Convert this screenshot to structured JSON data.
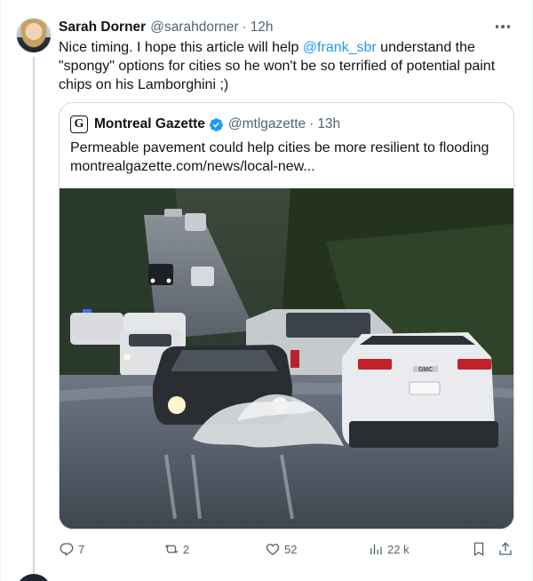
{
  "tweet": {
    "author_name": "Sarah Dorner",
    "author_handle": "@sarahdorner",
    "separator": "·",
    "time": "12h",
    "text_before": "Nice timing. I hope this article will help ",
    "mention": "@frank_sbr",
    "text_after": " understand the \"spongy\" options for cities so he won't be so terrified of potential paint chips on his Lamborghini ;)"
  },
  "quote": {
    "logo_letter": "G",
    "author_name": "Montreal Gazette",
    "author_handle": "@mtlgazette",
    "separator": "·",
    "time": "13h",
    "headline": "Permeable pavement could help cities be more resilient to flooding",
    "link": "montrealgazette.com/news/local-new...",
    "image_plate": "GMC"
  },
  "actions": {
    "reply_count": "7",
    "retweet_count": "2",
    "like_count": "52",
    "views_count": "22 k"
  },
  "colors": {
    "accent": "#1d9bf0",
    "text": "#0f1419",
    "muted": "#536471",
    "border": "#cfd9de"
  },
  "icons": [
    "more-icon",
    "verified-icon",
    "reply-icon",
    "retweet-icon",
    "like-icon",
    "views-icon",
    "bookmark-icon",
    "share-icon"
  ]
}
